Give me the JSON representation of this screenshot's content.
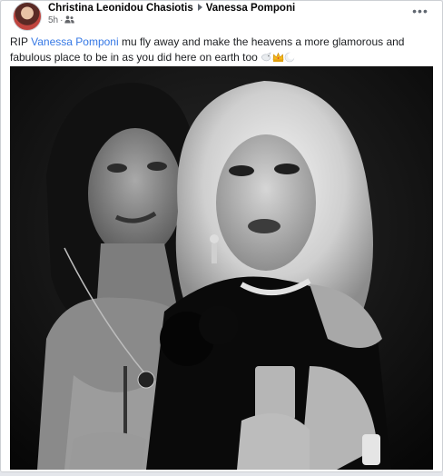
{
  "post": {
    "author": "Christina Leonidou Chasiotis",
    "target": "Vanessa Pomponi",
    "time": "5h",
    "dot": "·",
    "audience_icon": "friends-icon",
    "more_icon": "more-options-icon",
    "text_before": "RIP ",
    "mention": "Vanessa Pomponi",
    "text_after": " mu fly away and make the heavens a more glamorous and fabulous place to be in as you did here on earth too ",
    "emojis": [
      "dove-emoji",
      "crown-emoji",
      "moon-emoji"
    ]
  },
  "photo": {
    "description_icon": "photo-two-women",
    "style": "black-and-white"
  },
  "colors": {
    "link": "#3578e5",
    "name_text": "#050505",
    "meta_text": "#65676b",
    "card_border": "#cdd0d4",
    "page_bg": "#e4e6eb"
  }
}
